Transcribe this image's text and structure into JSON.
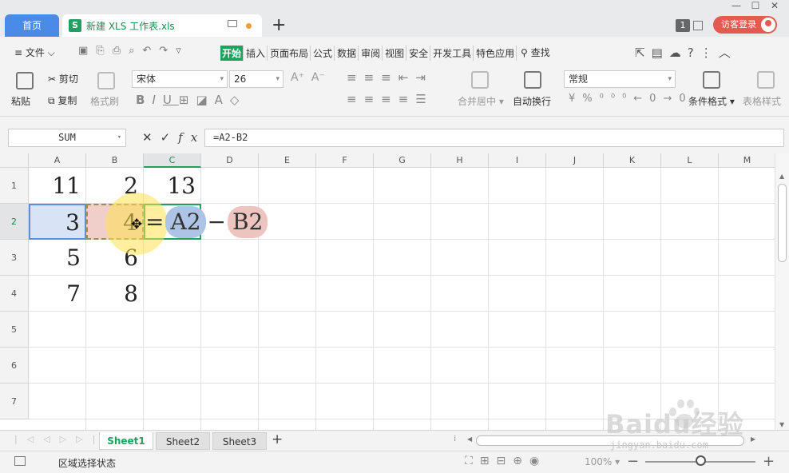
{
  "titlebar": {
    "home_tab": "首页",
    "doc_tab": "新建 XLS 工作表.xls",
    "doc_icon_letter": "S",
    "badge": "1",
    "login": "访客登录",
    "window_controls": [
      "—",
      "☐",
      "✕"
    ],
    "accent": "#4b8be8"
  },
  "menubar": {
    "file": "≡ 文件 ⌵",
    "tabs": [
      "开始",
      "插入",
      "页面布局",
      "公式",
      "数据",
      "审阅",
      "视图",
      "安全",
      "开发工具",
      "特色应用"
    ],
    "active_tab": "开始",
    "search": "查找"
  },
  "ribbon": {
    "paste": "粘贴",
    "cut": "剪切",
    "copy": "复制",
    "format_painter": "格式刷",
    "font_name": "宋体",
    "font_size": "26",
    "merge_center": "合并居中",
    "wrap_text": "自动换行",
    "number_format": "常规",
    "conditional_format": "条件格式",
    "table_style": "表格样式",
    "accent": "#1ca35d"
  },
  "formula_bar": {
    "name_box": "SUM",
    "formula": "=A2-B2",
    "cancel": "✕",
    "confirm": "✓",
    "fx": "fx"
  },
  "sheet": {
    "columns": [
      "A",
      "B",
      "C",
      "D",
      "E",
      "F",
      "G",
      "H",
      "I",
      "J",
      "K",
      "L",
      "M"
    ],
    "rows": [
      "1",
      "2",
      "3",
      "4",
      "5",
      "6",
      "7"
    ],
    "cells": {
      "A1": "11",
      "B1": "2",
      "C1": "13",
      "A2": "3",
      "B2": "4",
      "A3": "5",
      "B3": "6",
      "A4": "7",
      "B4": "8"
    },
    "editing": {
      "eq": "=",
      "ref1": "A2",
      "op": "−",
      "ref2": "B2"
    }
  },
  "sheet_tabs": [
    "Sheet1",
    "Sheet2",
    "Sheet3"
  ],
  "active_sheet": "Sheet1",
  "status": {
    "text": "区域选择状态",
    "zoom": "100%",
    "zoom_value": 0.5
  },
  "watermark": {
    "brand": "Baidu经验",
    "url": "jingyan.baidu.com"
  }
}
